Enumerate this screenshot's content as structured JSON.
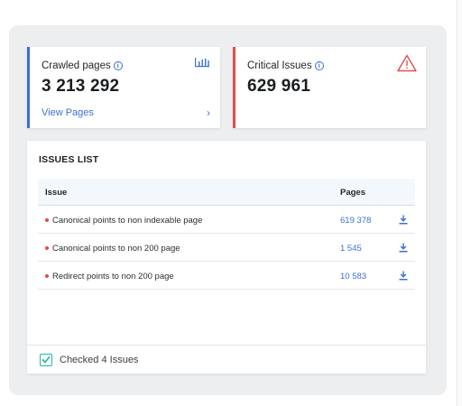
{
  "colors": {
    "accent_blue": "#3a6fd8",
    "critical_red": "#e24d4d",
    "check_teal": "#21b7a3"
  },
  "crawled": {
    "label": "Crawled pages",
    "value": "3 213 292",
    "link": "View Pages",
    "icons": [
      "info-icon",
      "bar-chart-icon",
      "chevron-right-icon"
    ]
  },
  "critical": {
    "label": "Critical Issues",
    "value": "629 961",
    "icons": [
      "info-icon",
      "warning-triangle-icon"
    ]
  },
  "issues": {
    "title": "ISSUES LIST",
    "columns": {
      "issue": "Issue",
      "pages": "Pages"
    },
    "rows": [
      {
        "issue": "Canonical points to non indexable page",
        "pages": "619 378"
      },
      {
        "issue": "Canonical points to non 200 page",
        "pages": "1 545"
      },
      {
        "issue": "Redirect points to non 200 page",
        "pages": "10 583"
      }
    ],
    "footer": {
      "checked_label": "Checked 4 Issues"
    }
  }
}
